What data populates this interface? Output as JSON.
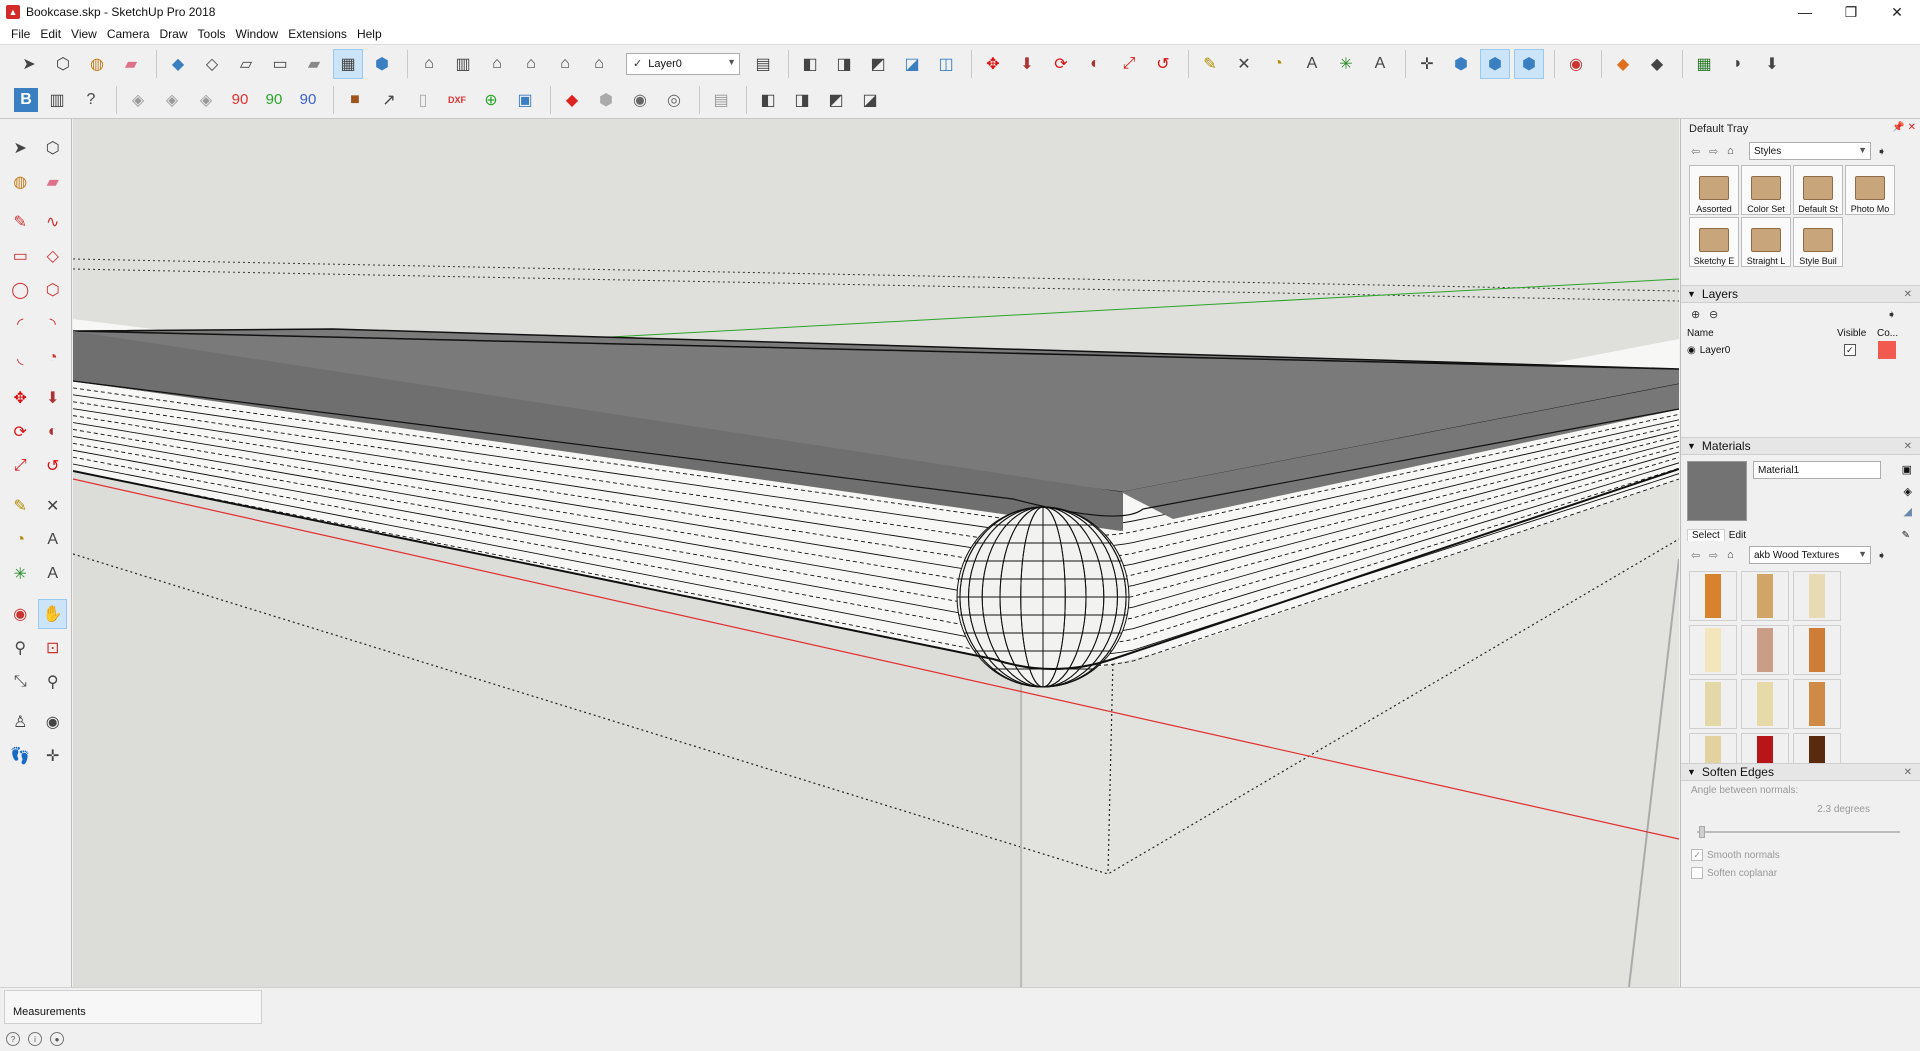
{
  "window": {
    "title": "Bookcase.skp - SketchUp Pro 2018"
  },
  "menu": [
    "File",
    "Edit",
    "View",
    "Camera",
    "Draw",
    "Tools",
    "Window",
    "Extensions",
    "Help"
  ],
  "toolbar": {
    "layer_select": "Layer0",
    "angles": [
      "90",
      "90",
      "90"
    ],
    "dxf_label": "DXF",
    "section_label": "B"
  },
  "tray": {
    "title": "Default Tray",
    "styles": {
      "combo": "Styles",
      "items": [
        "Assorted",
        "Color Set",
        "Default St",
        "Photo Mo",
        "Sketchy E",
        "Straight L",
        "Style Buil"
      ]
    },
    "layers": {
      "title": "Layers",
      "headers": {
        "name": "Name",
        "visible": "Visible",
        "color": "Co..."
      },
      "rows": [
        {
          "name": "Layer0",
          "color": "#f25a4f"
        }
      ]
    },
    "materials": {
      "title": "Materials",
      "name": "Material1",
      "preview_color": "#737373",
      "tabs": [
        "Select",
        "Edit"
      ],
      "library": "akb Wood Textures",
      "textures": [
        "#d9822e",
        "#cfa668",
        "#e8dbb3",
        "#f3e5bc",
        "#c99d86",
        "#cf7c38",
        "#e4d7a8",
        "#e7daa9",
        "#cf8a45",
        "#e2d2a0",
        "#b8151a",
        "#5a2a0f"
      ]
    },
    "soften": {
      "title": "Soften Edges",
      "angle_label": "Angle between normals:",
      "angle_value": "2.3 degrees",
      "smooth": "Smooth normals",
      "coplanar": "Soften coplanar"
    }
  },
  "status": {
    "measurements": "Measurements"
  }
}
